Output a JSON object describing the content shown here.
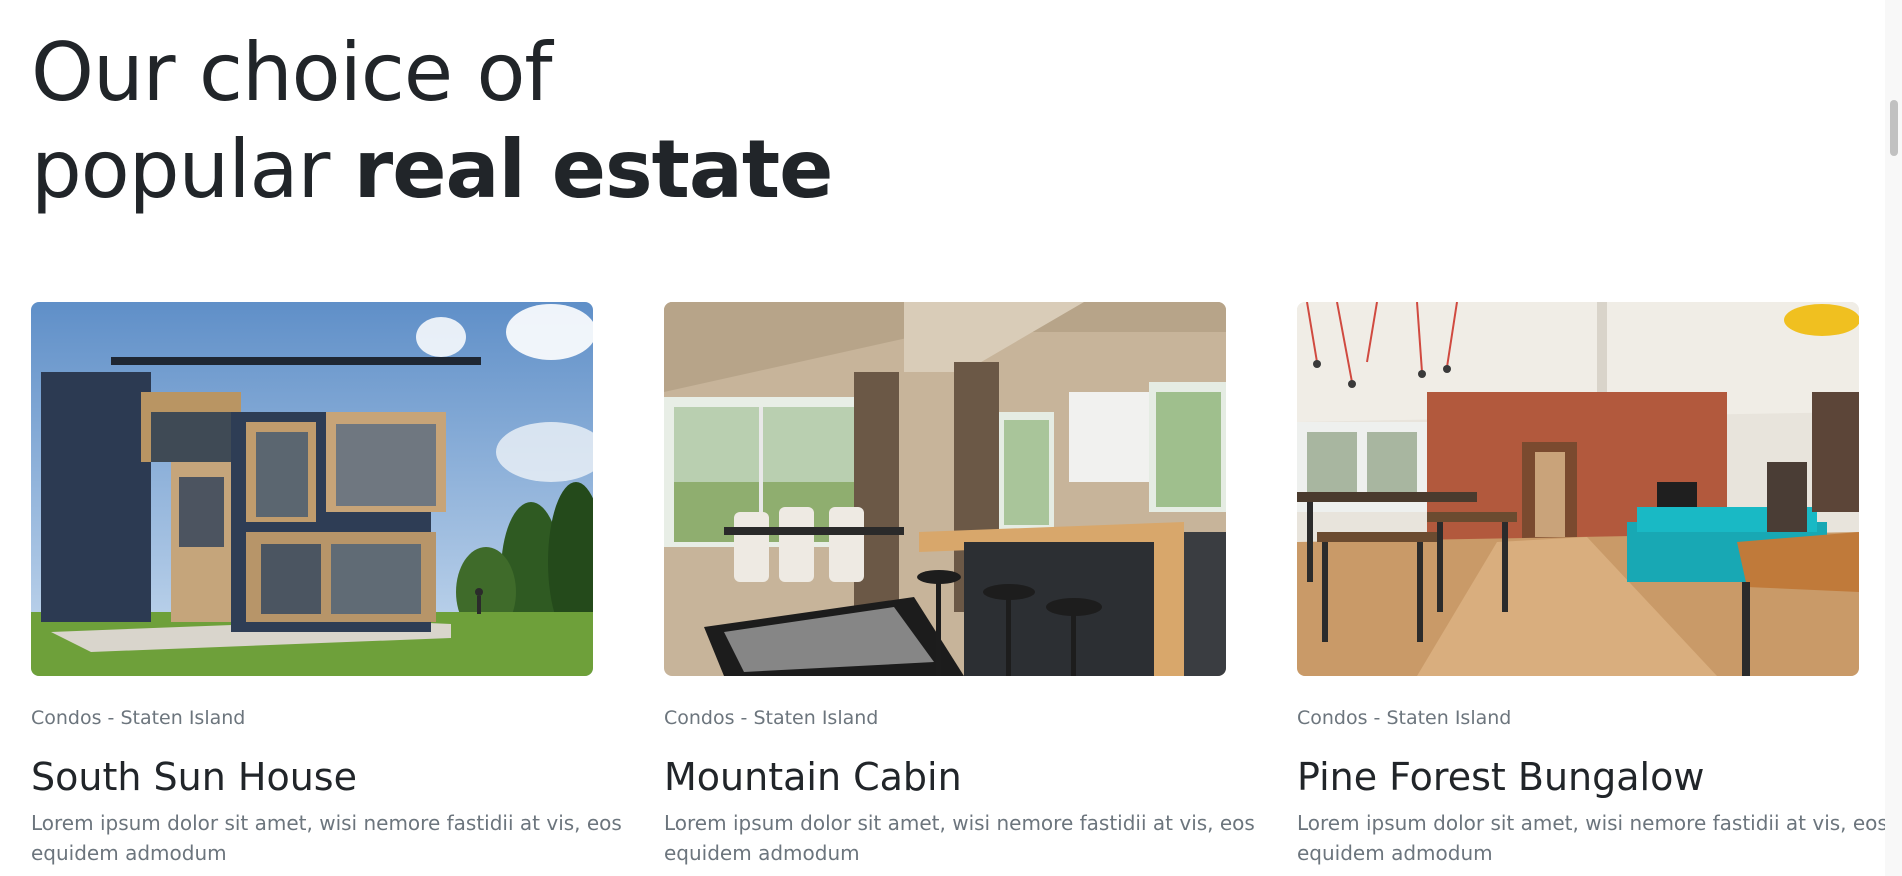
{
  "heading": {
    "line1": "Our choice of",
    "line2_regular": "popular ",
    "line2_bold": "real estate"
  },
  "cards": [
    {
      "category": "Condos - Staten Island",
      "title": "South Sun House",
      "text": "Lorem ipsum dolor sit amet, wisi nemore fastidii at vis, eos equidem admodum",
      "image": "modern-house-exterior"
    },
    {
      "category": "Condos - Staten Island",
      "title": "Mountain Cabin",
      "text": "Lorem ipsum dolor sit amet, wisi nemore fastidii at vis, eos equidem admodum",
      "image": "cabin-kitchen-interior"
    },
    {
      "category": "Condos - Staten Island",
      "title": "Pine Forest Bungalow",
      "text": "Lorem ipsum dolor sit amet, wisi nemore fastidii at vis, eos equidem admodum",
      "image": "loft-living-room-interior"
    }
  ]
}
